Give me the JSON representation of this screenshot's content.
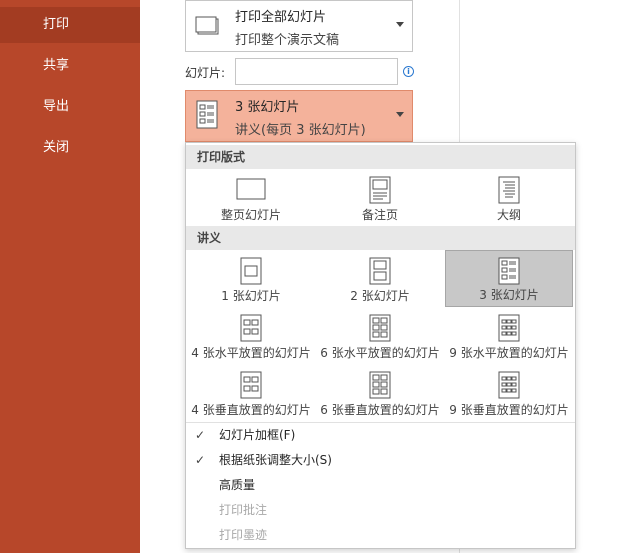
{
  "sidebar": {
    "items": [
      {
        "label": "打印",
        "active": true
      },
      {
        "label": "共享"
      },
      {
        "label": "导出"
      },
      {
        "label": "关闭"
      }
    ]
  },
  "print_range": {
    "title": "打印全部幻灯片",
    "subtitle": "打印整个演示文稿"
  },
  "slides": {
    "label": "幻灯片:",
    "value": "",
    "info_icon": "i"
  },
  "layout_dropdown": {
    "title": "3 张幻灯片",
    "subtitle": "讲义(每页 3 张幻灯片)"
  },
  "panel": {
    "print_layout_heading": "打印版式",
    "print_layout_options": [
      {
        "label": "整页幻灯片",
        "icon": "full-page-icon"
      },
      {
        "label": "备注页",
        "icon": "notes-page-icon"
      },
      {
        "label": "大纲",
        "icon": "outline-icon"
      }
    ],
    "handouts_heading": "讲义",
    "handout_options": [
      {
        "label": "1 张幻灯片",
        "icon": "handout-1-icon"
      },
      {
        "label": "2 张幻灯片",
        "icon": "handout-2-icon"
      },
      {
        "label": "3 张幻灯片",
        "icon": "handout-3-icon",
        "selected": true
      },
      {
        "label": "4 张水平放置的幻灯片",
        "icon": "handout-4h-icon"
      },
      {
        "label": "6 张水平放置的幻灯片",
        "icon": "handout-6h-icon"
      },
      {
        "label": "9 张水平放置的幻灯片",
        "icon": "handout-9h-icon"
      },
      {
        "label": "4 张垂直放置的幻灯片",
        "icon": "handout-4v-icon"
      },
      {
        "label": "6 张垂直放置的幻灯片",
        "icon": "handout-6v-icon"
      },
      {
        "label": "9 张垂直放置的幻灯片",
        "icon": "handout-9v-icon"
      }
    ],
    "toggles": [
      {
        "label": "幻灯片加框(F)",
        "checked": true,
        "enabled": true
      },
      {
        "label": "根据纸张调整大小(S)",
        "checked": true,
        "enabled": true
      },
      {
        "label": "高质量",
        "checked": false,
        "enabled": true
      },
      {
        "label": "打印批注",
        "checked": false,
        "enabled": false
      },
      {
        "label": "打印墨迹",
        "checked": false,
        "enabled": false
      }
    ],
    "check_mark": "✓"
  },
  "colors": {
    "sidebar": "#b7472a",
    "sidebar_active": "#a33c22",
    "selected_dropdown": "#f4b29b"
  }
}
